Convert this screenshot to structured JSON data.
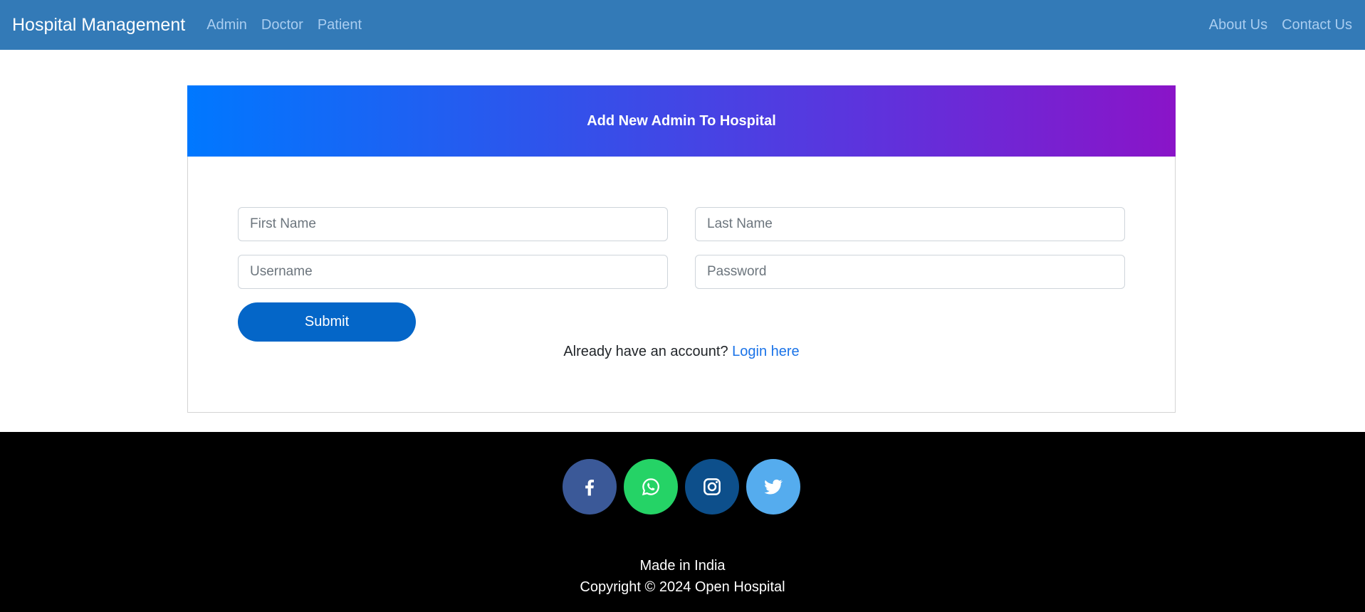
{
  "nav": {
    "brand": "Hospital Management",
    "left_links": [
      "Admin",
      "Doctor",
      "Patient"
    ],
    "right_links": [
      "About Us",
      "Contact Us"
    ]
  },
  "form": {
    "title": "Add New Admin To Hospital",
    "first_name_placeholder": "First Name",
    "last_name_placeholder": "Last Name",
    "username_placeholder": "Username",
    "password_placeholder": "Password",
    "submit_label": "Submit",
    "login_prompt": "Already have an account?",
    "login_link": "Login here"
  },
  "footer": {
    "socials": [
      {
        "icon": "facebook-icon",
        "color": "#3b5998"
      },
      {
        "icon": "whatsapp-icon",
        "color": "#25d366"
      },
      {
        "icon": "instagram-icon",
        "color": "#0d4f8b"
      },
      {
        "icon": "twitter-icon",
        "color": "#55acee"
      }
    ],
    "made_in": "Made in India",
    "copyright": "Copyright © 2024 Open Hospital"
  }
}
